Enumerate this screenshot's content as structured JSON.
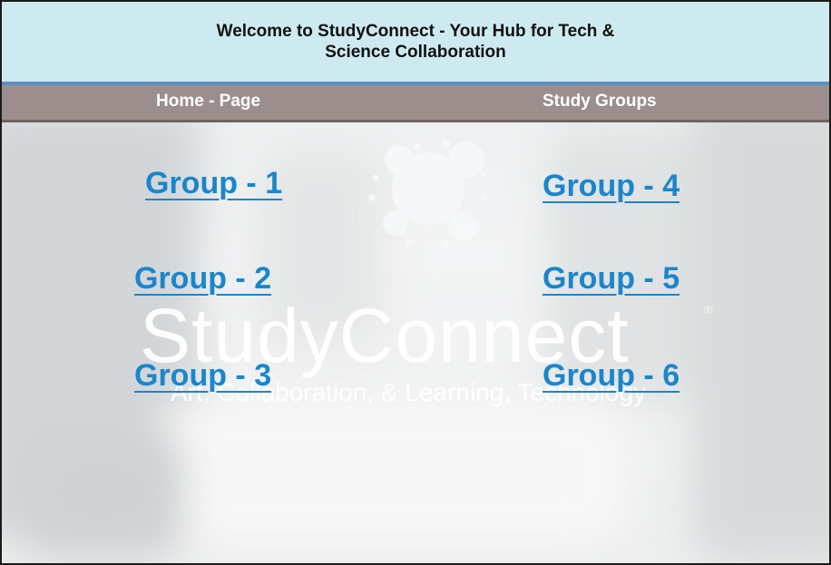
{
  "header": {
    "title": "Welcome to StudyConnect - Your Hub for Tech & Science Collaboration"
  },
  "nav": {
    "home_label": "Home - Page",
    "study_groups_label": "Study Groups"
  },
  "groups": [
    {
      "label": "Group - 1"
    },
    {
      "label": "Group - 2"
    },
    {
      "label": "Group - 3"
    },
    {
      "label": "Group - 4"
    },
    {
      "label": "Group - 5"
    },
    {
      "label": "Group - 6"
    }
  ],
  "watermark": {
    "name": "StudyConnect",
    "registered": "®",
    "tagline": "Art, Collaboration, & Learning, Technology"
  },
  "colors": {
    "header_bg": "#cdeaf0",
    "header_border": "#5b8fbf",
    "nav_bg": "#9b8e8c",
    "link_color": "#1a86cc"
  },
  "icons": {
    "logo": "studyconnect-logo-icon"
  }
}
